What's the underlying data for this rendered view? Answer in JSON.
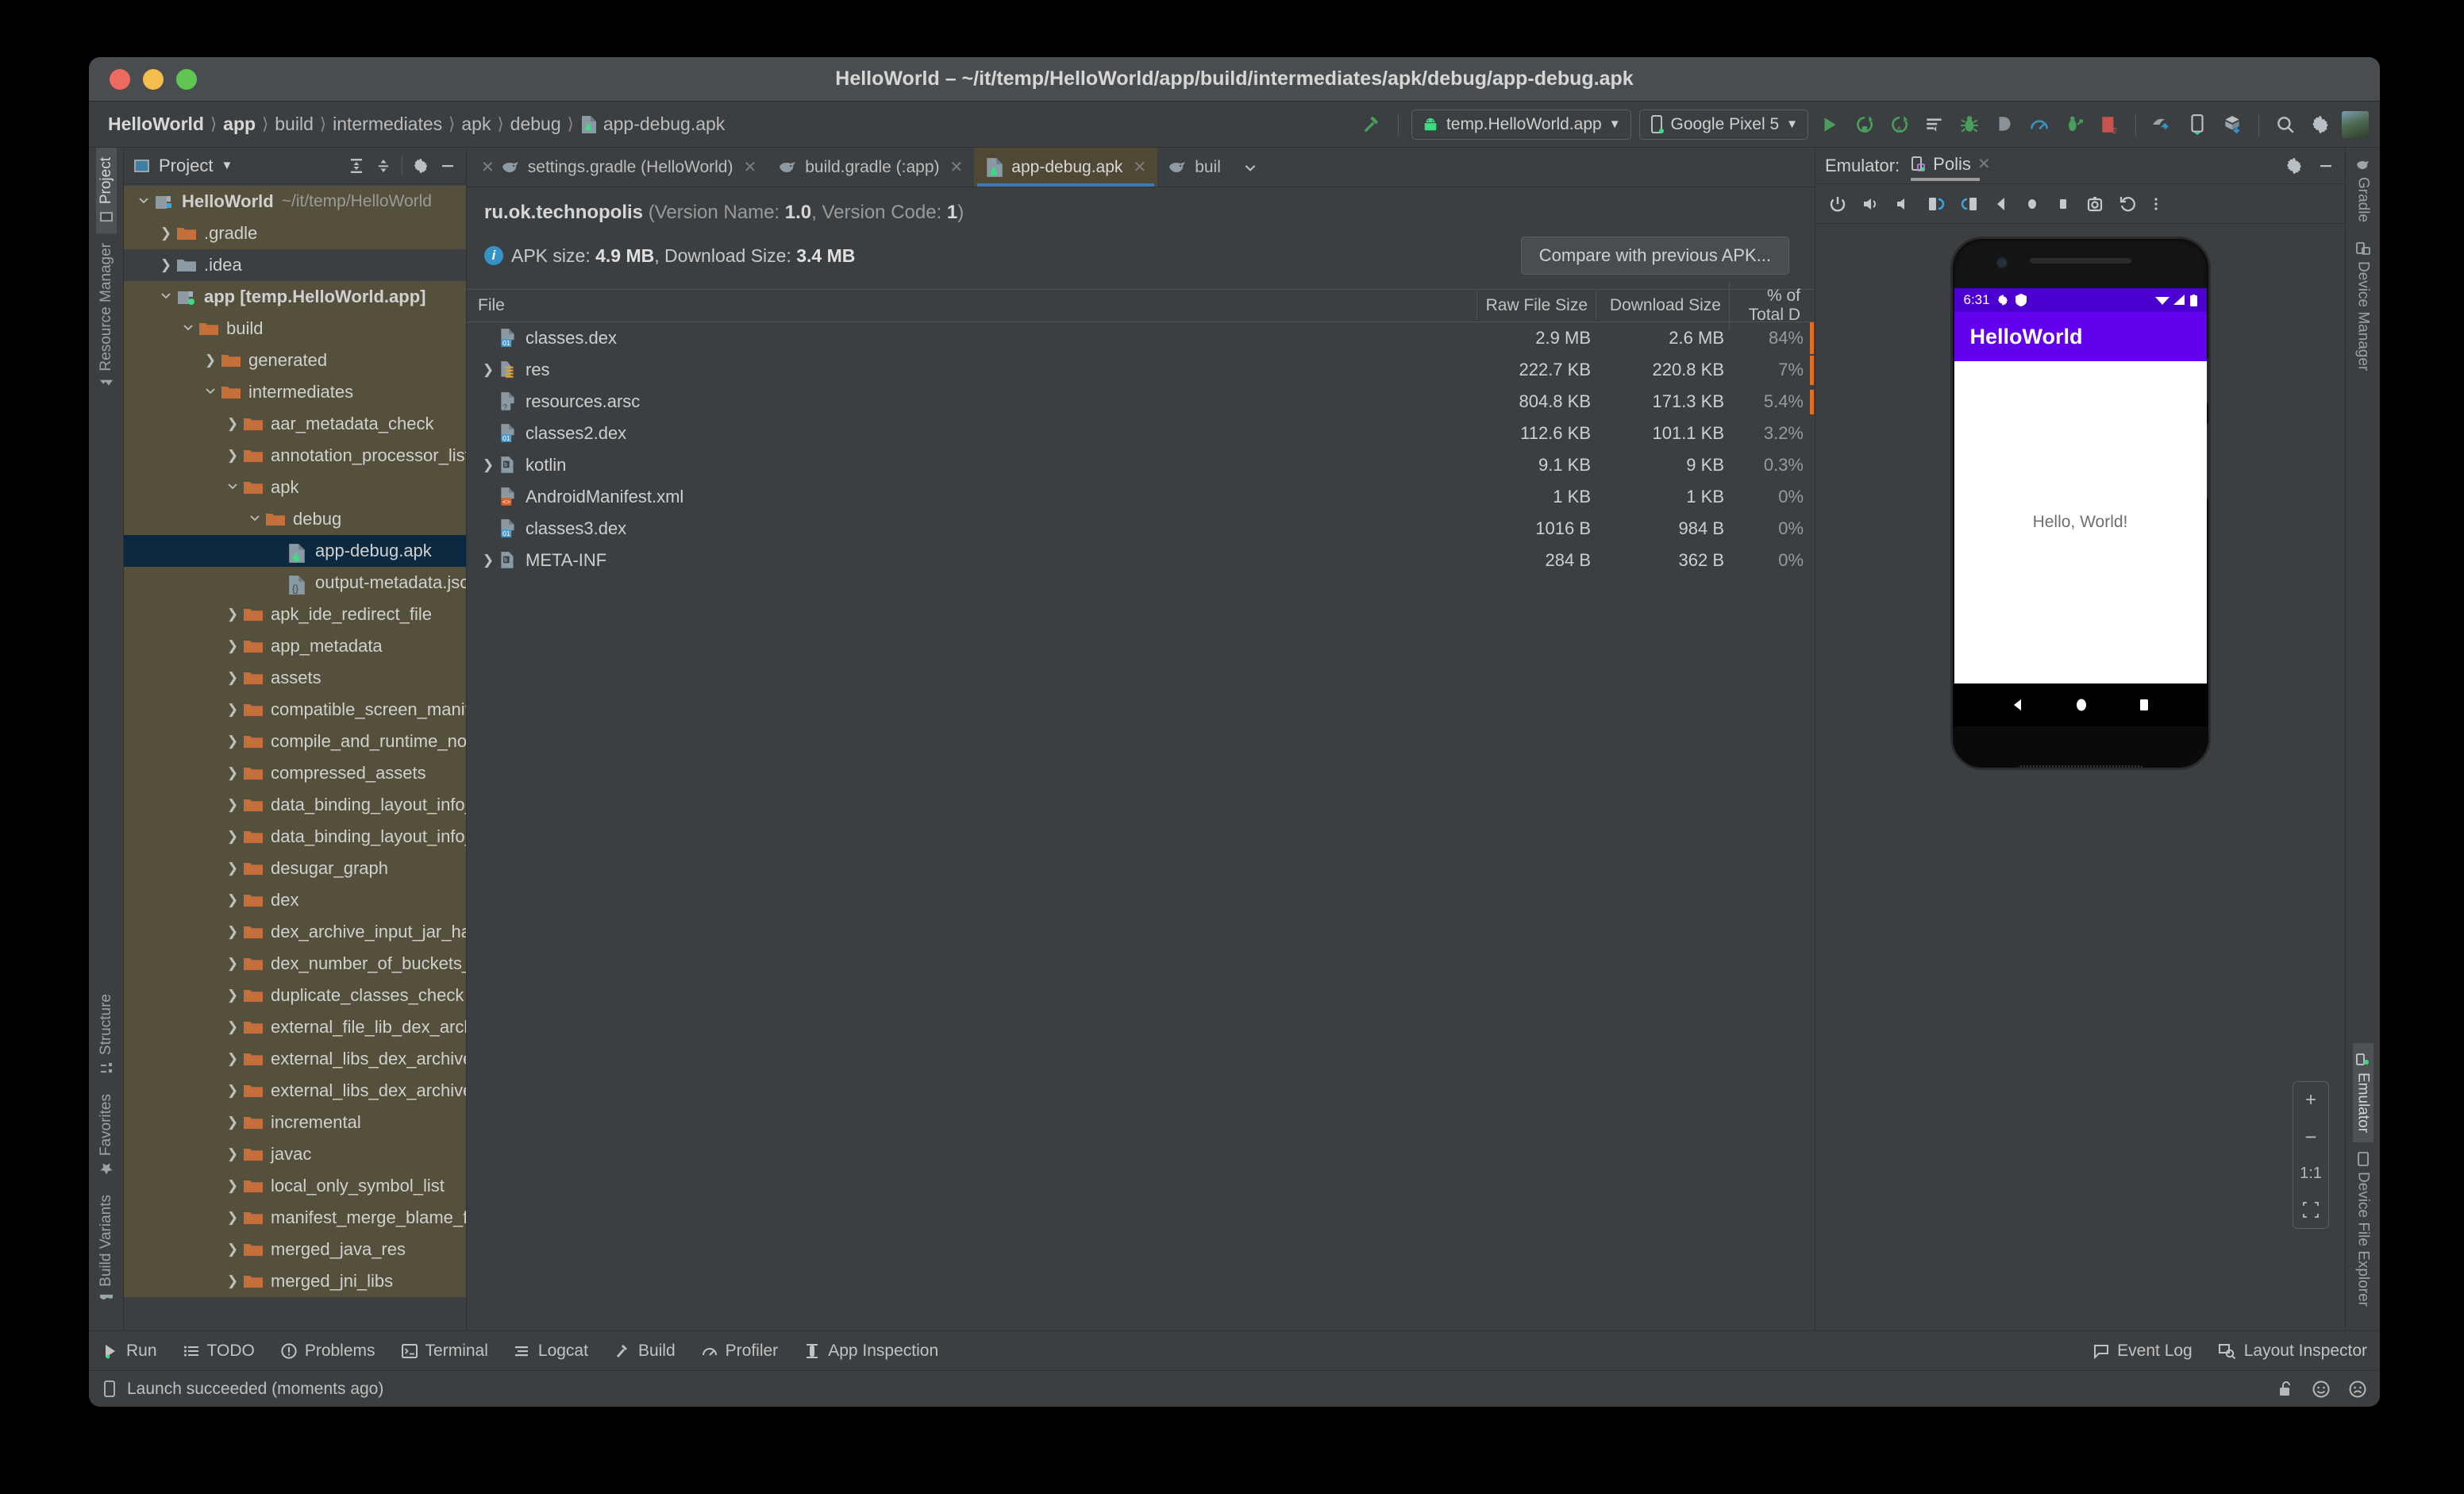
{
  "window": {
    "title": "HelloWorld – ~/it/temp/HelloWorld/app/build/intermediates/apk/debug/app-debug.apk"
  },
  "breadcrumbs": [
    {
      "label": "HelloWorld",
      "bold": true
    },
    {
      "label": "app",
      "bold": true
    },
    {
      "label": "build",
      "bold": false
    },
    {
      "label": "intermediates",
      "bold": false
    },
    {
      "label": "apk",
      "bold": false
    },
    {
      "label": "debug",
      "bold": false
    },
    {
      "label": "app-debug.apk",
      "bold": false,
      "icon": "apk-icon"
    }
  ],
  "toolbar": {
    "run_config": "temp.HelloWorld.app",
    "device": "Google Pixel 5",
    "icons": [
      "build-hammer-icon",
      "run-icon",
      "run-with-coverage-icon",
      "apply-changes-icon",
      "debug-icon",
      "step-icon",
      "profiler-icon",
      "attach-debugger-icon",
      "stop-icon",
      "sync-gradle-icon",
      "avd-manager-icon",
      "sdk-manager-icon",
      "search-icon",
      "settings-gear-icon",
      "user-avatar"
    ]
  },
  "left_tool_tabs": [
    {
      "label": "Project",
      "icon": "project-icon",
      "selected": true
    },
    {
      "label": "Resource Manager",
      "icon": "resource-manager-icon",
      "selected": false
    },
    {
      "label": "Structure",
      "icon": "structure-icon",
      "selected": false
    },
    {
      "label": "Favorites",
      "icon": "star-icon",
      "selected": false
    },
    {
      "label": "Build Variants",
      "icon": "build-variants-icon",
      "selected": false
    }
  ],
  "right_tool_tabs": [
    {
      "label": "Gradle",
      "icon": "gradle-elephant-icon",
      "selected": false
    },
    {
      "label": "Device Manager",
      "icon": "device-manager-icon",
      "selected": false
    },
    {
      "label": "Emulator",
      "icon": "emulator-icon",
      "selected": true
    },
    {
      "label": "Device File Explorer",
      "icon": "device-file-explorer-icon",
      "selected": false
    }
  ],
  "project_panel": {
    "title": "Project",
    "header_icons": [
      "expand-all-icon",
      "collapse-all-icon",
      "settings-gear-icon",
      "hide-panel-icon"
    ],
    "tree": [
      {
        "depth": 0,
        "label": "HelloWorld",
        "suffix": "~/it/temp/HelloWorld",
        "arrow": "down",
        "icon": "module-icon",
        "bold": true,
        "state": "highlight"
      },
      {
        "depth": 1,
        "label": ".gradle",
        "arrow": "right",
        "icon": "folder-orange",
        "state": "highlight"
      },
      {
        "depth": 1,
        "label": ".idea",
        "arrow": "right",
        "icon": "folder-gray",
        "state": "none"
      },
      {
        "depth": 1,
        "label": "app [temp.HelloWorld.app]",
        "arrow": "down",
        "icon": "module-icon",
        "bold": true,
        "state": "highlight"
      },
      {
        "depth": 2,
        "label": "build",
        "arrow": "down",
        "icon": "folder-orange",
        "state": "highlight"
      },
      {
        "depth": 3,
        "label": "generated",
        "arrow": "right",
        "icon": "folder-orange",
        "state": "highlight"
      },
      {
        "depth": 3,
        "label": "intermediates",
        "arrow": "down",
        "icon": "folder-orange",
        "state": "highlight"
      },
      {
        "depth": 4,
        "label": "aar_metadata_check",
        "arrow": "right",
        "icon": "folder-orange",
        "state": "highlight"
      },
      {
        "depth": 4,
        "label": "annotation_processor_list",
        "arrow": "right",
        "icon": "folder-orange",
        "state": "highlight"
      },
      {
        "depth": 4,
        "label": "apk",
        "arrow": "down",
        "icon": "folder-orange",
        "state": "highlight"
      },
      {
        "depth": 5,
        "label": "debug",
        "arrow": "down",
        "icon": "folder-orange",
        "state": "highlight"
      },
      {
        "depth": 6,
        "label": "app-debug.apk",
        "arrow": "none",
        "icon": "apk-icon",
        "state": "selected"
      },
      {
        "depth": 6,
        "label": "output-metadata.json",
        "arrow": "none",
        "icon": "json-icon",
        "state": "highlight"
      },
      {
        "depth": 4,
        "label": "apk_ide_redirect_file",
        "arrow": "right",
        "icon": "folder-orange",
        "state": "highlight"
      },
      {
        "depth": 4,
        "label": "app_metadata",
        "arrow": "right",
        "icon": "folder-orange",
        "state": "highlight"
      },
      {
        "depth": 4,
        "label": "assets",
        "arrow": "right",
        "icon": "folder-orange",
        "state": "highlight"
      },
      {
        "depth": 4,
        "label": "compatible_screen_manifest",
        "arrow": "right",
        "icon": "folder-orange",
        "state": "highlight"
      },
      {
        "depth": 4,
        "label": "compile_and_runtime_not_namespaced",
        "arrow": "right",
        "icon": "folder-orange",
        "state": "highlight"
      },
      {
        "depth": 4,
        "label": "compressed_assets",
        "arrow": "right",
        "icon": "folder-orange",
        "state": "highlight"
      },
      {
        "depth": 4,
        "label": "data_binding_layout_info_type_merge",
        "arrow": "right",
        "icon": "folder-orange",
        "state": "highlight"
      },
      {
        "depth": 4,
        "label": "data_binding_layout_info_type_package",
        "arrow": "right",
        "icon": "folder-orange",
        "state": "highlight"
      },
      {
        "depth": 4,
        "label": "desugar_graph",
        "arrow": "right",
        "icon": "folder-orange",
        "state": "highlight"
      },
      {
        "depth": 4,
        "label": "dex",
        "arrow": "right",
        "icon": "folder-orange",
        "state": "highlight"
      },
      {
        "depth": 4,
        "label": "dex_archive_input_jar_hashes",
        "arrow": "right",
        "icon": "folder-orange",
        "state": "highlight"
      },
      {
        "depth": 4,
        "label": "dex_number_of_buckets_file",
        "arrow": "right",
        "icon": "folder-orange",
        "state": "highlight"
      },
      {
        "depth": 4,
        "label": "duplicate_classes_check",
        "arrow": "right",
        "icon": "folder-orange",
        "state": "highlight"
      },
      {
        "depth": 4,
        "label": "external_file_lib_dex_archives",
        "arrow": "right",
        "icon": "folder-orange",
        "state": "highlight"
      },
      {
        "depth": 4,
        "label": "external_libs_dex_archive",
        "arrow": "right",
        "icon": "folder-orange",
        "state": "highlight"
      },
      {
        "depth": 4,
        "label": "external_libs_dex_archive_with_artifact",
        "arrow": "right",
        "icon": "folder-orange",
        "state": "highlight"
      },
      {
        "depth": 4,
        "label": "incremental",
        "arrow": "right",
        "icon": "folder-orange",
        "state": "highlight"
      },
      {
        "depth": 4,
        "label": "javac",
        "arrow": "right",
        "icon": "folder-orange",
        "state": "highlight"
      },
      {
        "depth": 4,
        "label": "local_only_symbol_list",
        "arrow": "right",
        "icon": "folder-orange",
        "state": "highlight"
      },
      {
        "depth": 4,
        "label": "manifest_merge_blame_file",
        "arrow": "right",
        "icon": "folder-orange",
        "state": "highlight"
      },
      {
        "depth": 4,
        "label": "merged_java_res",
        "arrow": "right",
        "icon": "folder-orange",
        "state": "highlight"
      },
      {
        "depth": 4,
        "label": "merged_jni_libs",
        "arrow": "right",
        "icon": "folder-orange",
        "state": "highlight"
      }
    ]
  },
  "editor": {
    "tabs": [
      {
        "label": "settings.gradle (HelloWorld)",
        "icon": "gradle-elephant-icon",
        "active": false,
        "closable": true
      },
      {
        "label": "build.gradle (:app)",
        "icon": "gradle-elephant-icon",
        "active": false,
        "closable": true
      },
      {
        "label": "app-debug.apk",
        "icon": "apk-icon",
        "active": true,
        "closable": true
      },
      {
        "label": "buil",
        "icon": "gradle-elephant-icon",
        "active": false,
        "closable": false
      }
    ],
    "tab_overflow": "chevron-down-icon"
  },
  "apk_analyzer": {
    "package": "ru.ok.technopolis",
    "version_meta_prefix": "(Version Name: ",
    "version_name": "1.0",
    "version_meta_mid": ", Version Code: ",
    "version_code": "1",
    "version_meta_suffix": ")",
    "apk_size_label": "APK size:",
    "apk_size": "4.9 MB",
    "download_size_label": "Download Size:",
    "download_size": "3.4 MB",
    "compare_button": "Compare with previous APK...",
    "columns": {
      "file": "File",
      "raw": "Raw File Size",
      "download": "Download Size",
      "percent": "% of Total D"
    },
    "rows": [
      {
        "name": "classes.dex",
        "icon": "dex-file-icon",
        "raw": "2.9 MB",
        "download": "2.6 MB",
        "percent": "84%",
        "bar_pct": 100,
        "expandable": false
      },
      {
        "name": "res",
        "icon": "res-folder-icon",
        "raw": "222.7 KB",
        "download": "220.8 KB",
        "percent": "7%",
        "bar_pct": 92,
        "expandable": true
      },
      {
        "name": "resources.arsc",
        "icon": "arsc-file-icon",
        "raw": "804.8 KB",
        "download": "171.3 KB",
        "percent": "5.4%",
        "bar_pct": 78,
        "expandable": false
      },
      {
        "name": "classes2.dex",
        "icon": "dex-file-icon",
        "raw": "112.6 KB",
        "download": "101.1 KB",
        "percent": "3.2%",
        "bar_pct": 0,
        "expandable": false
      },
      {
        "name": "kotlin",
        "icon": "binary-folder-icon",
        "raw": "9.1 KB",
        "download": "9 KB",
        "percent": "0.3%",
        "bar_pct": 0,
        "expandable": true
      },
      {
        "name": "AndroidManifest.xml",
        "icon": "xml-file-icon",
        "raw": "1 KB",
        "download": "1 KB",
        "percent": "0%",
        "bar_pct": 0,
        "expandable": false
      },
      {
        "name": "classes3.dex",
        "icon": "dex-file-icon",
        "raw": "1016 B",
        "download": "984 B",
        "percent": "0%",
        "bar_pct": 0,
        "expandable": false
      },
      {
        "name": "META-INF",
        "icon": "binary-folder-icon",
        "raw": "284 B",
        "download": "362 B",
        "percent": "0%",
        "bar_pct": 0,
        "expandable": true
      }
    ]
  },
  "emulator": {
    "panel_label": "Emulator:",
    "tab_label": "Polis",
    "header_icons": [
      "settings-gear-icon",
      "hide-panel-icon"
    ],
    "controls": [
      "power-icon",
      "volume-up-icon",
      "volume-down-icon",
      "rotate-left-icon",
      "rotate-right-icon",
      "back-icon",
      "home-icon",
      "overview-icon",
      "screenshot-icon",
      "history-icon",
      "more-vertical-icon"
    ],
    "zoom_controls": [
      "zoom-in-icon",
      "zoom-out-icon",
      "zoom-actual-label",
      "zoom-fit-icon"
    ],
    "zoom_actual_label": "1:1",
    "device_screen": {
      "status_time": "6:31",
      "status_icons": [
        "gear-icon",
        "shield-icon"
      ],
      "status_right_icons": [
        "wifi-icon",
        "signal-icon",
        "battery-icon"
      ],
      "app_title": "HelloWorld",
      "body_text": "Hello, World!",
      "nav_buttons": [
        "back-triangle-icon",
        "home-circle-icon",
        "recents-square-icon"
      ],
      "appbar_color": "#6200ee",
      "statusbar_color": "#4b00d0"
    }
  },
  "bottom_bar": {
    "items": [
      {
        "label": "Run",
        "icon": "run-icon"
      },
      {
        "label": "TODO",
        "icon": "todo-icon"
      },
      {
        "label": "Problems",
        "icon": "problems-icon"
      },
      {
        "label": "Terminal",
        "icon": "terminal-icon"
      },
      {
        "label": "Logcat",
        "icon": "logcat-icon"
      },
      {
        "label": "Build",
        "icon": "build-hammer-icon"
      },
      {
        "label": "Profiler",
        "icon": "profiler-icon"
      },
      {
        "label": "App Inspection",
        "icon": "app-inspection-icon"
      }
    ],
    "right_items": [
      {
        "label": "Event Log",
        "icon": "event-log-icon"
      },
      {
        "label": "Layout Inspector",
        "icon": "layout-inspector-icon"
      }
    ]
  },
  "status_bar": {
    "message": "Launch succeeded (moments ago)",
    "icon": "device-icon",
    "right_icons": [
      "lock-open-icon",
      "feedback-happy-icon",
      "feedback-sad-icon"
    ]
  }
}
